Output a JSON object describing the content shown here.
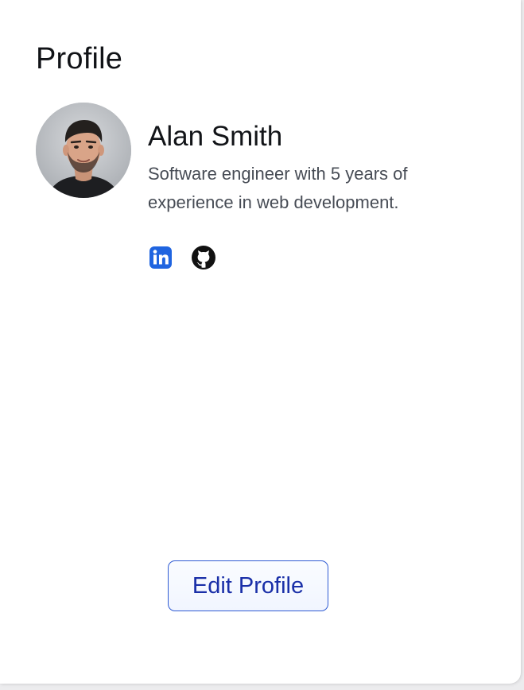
{
  "header": {
    "title": "Profile"
  },
  "profile": {
    "name": "Alan Smith",
    "bio": "Software engineer with 5 years of experience in web development.",
    "avatar_icon": "user-photo"
  },
  "social": [
    {
      "icon": "linkedin-icon",
      "color": "#1f64e0"
    },
    {
      "icon": "github-icon",
      "color": "#111111"
    }
  ],
  "actions": {
    "edit_label": "Edit Profile"
  },
  "theme": {
    "accent": "#2f5bd3",
    "button_text": "#1a2fa8",
    "background": "#ffffff"
  }
}
